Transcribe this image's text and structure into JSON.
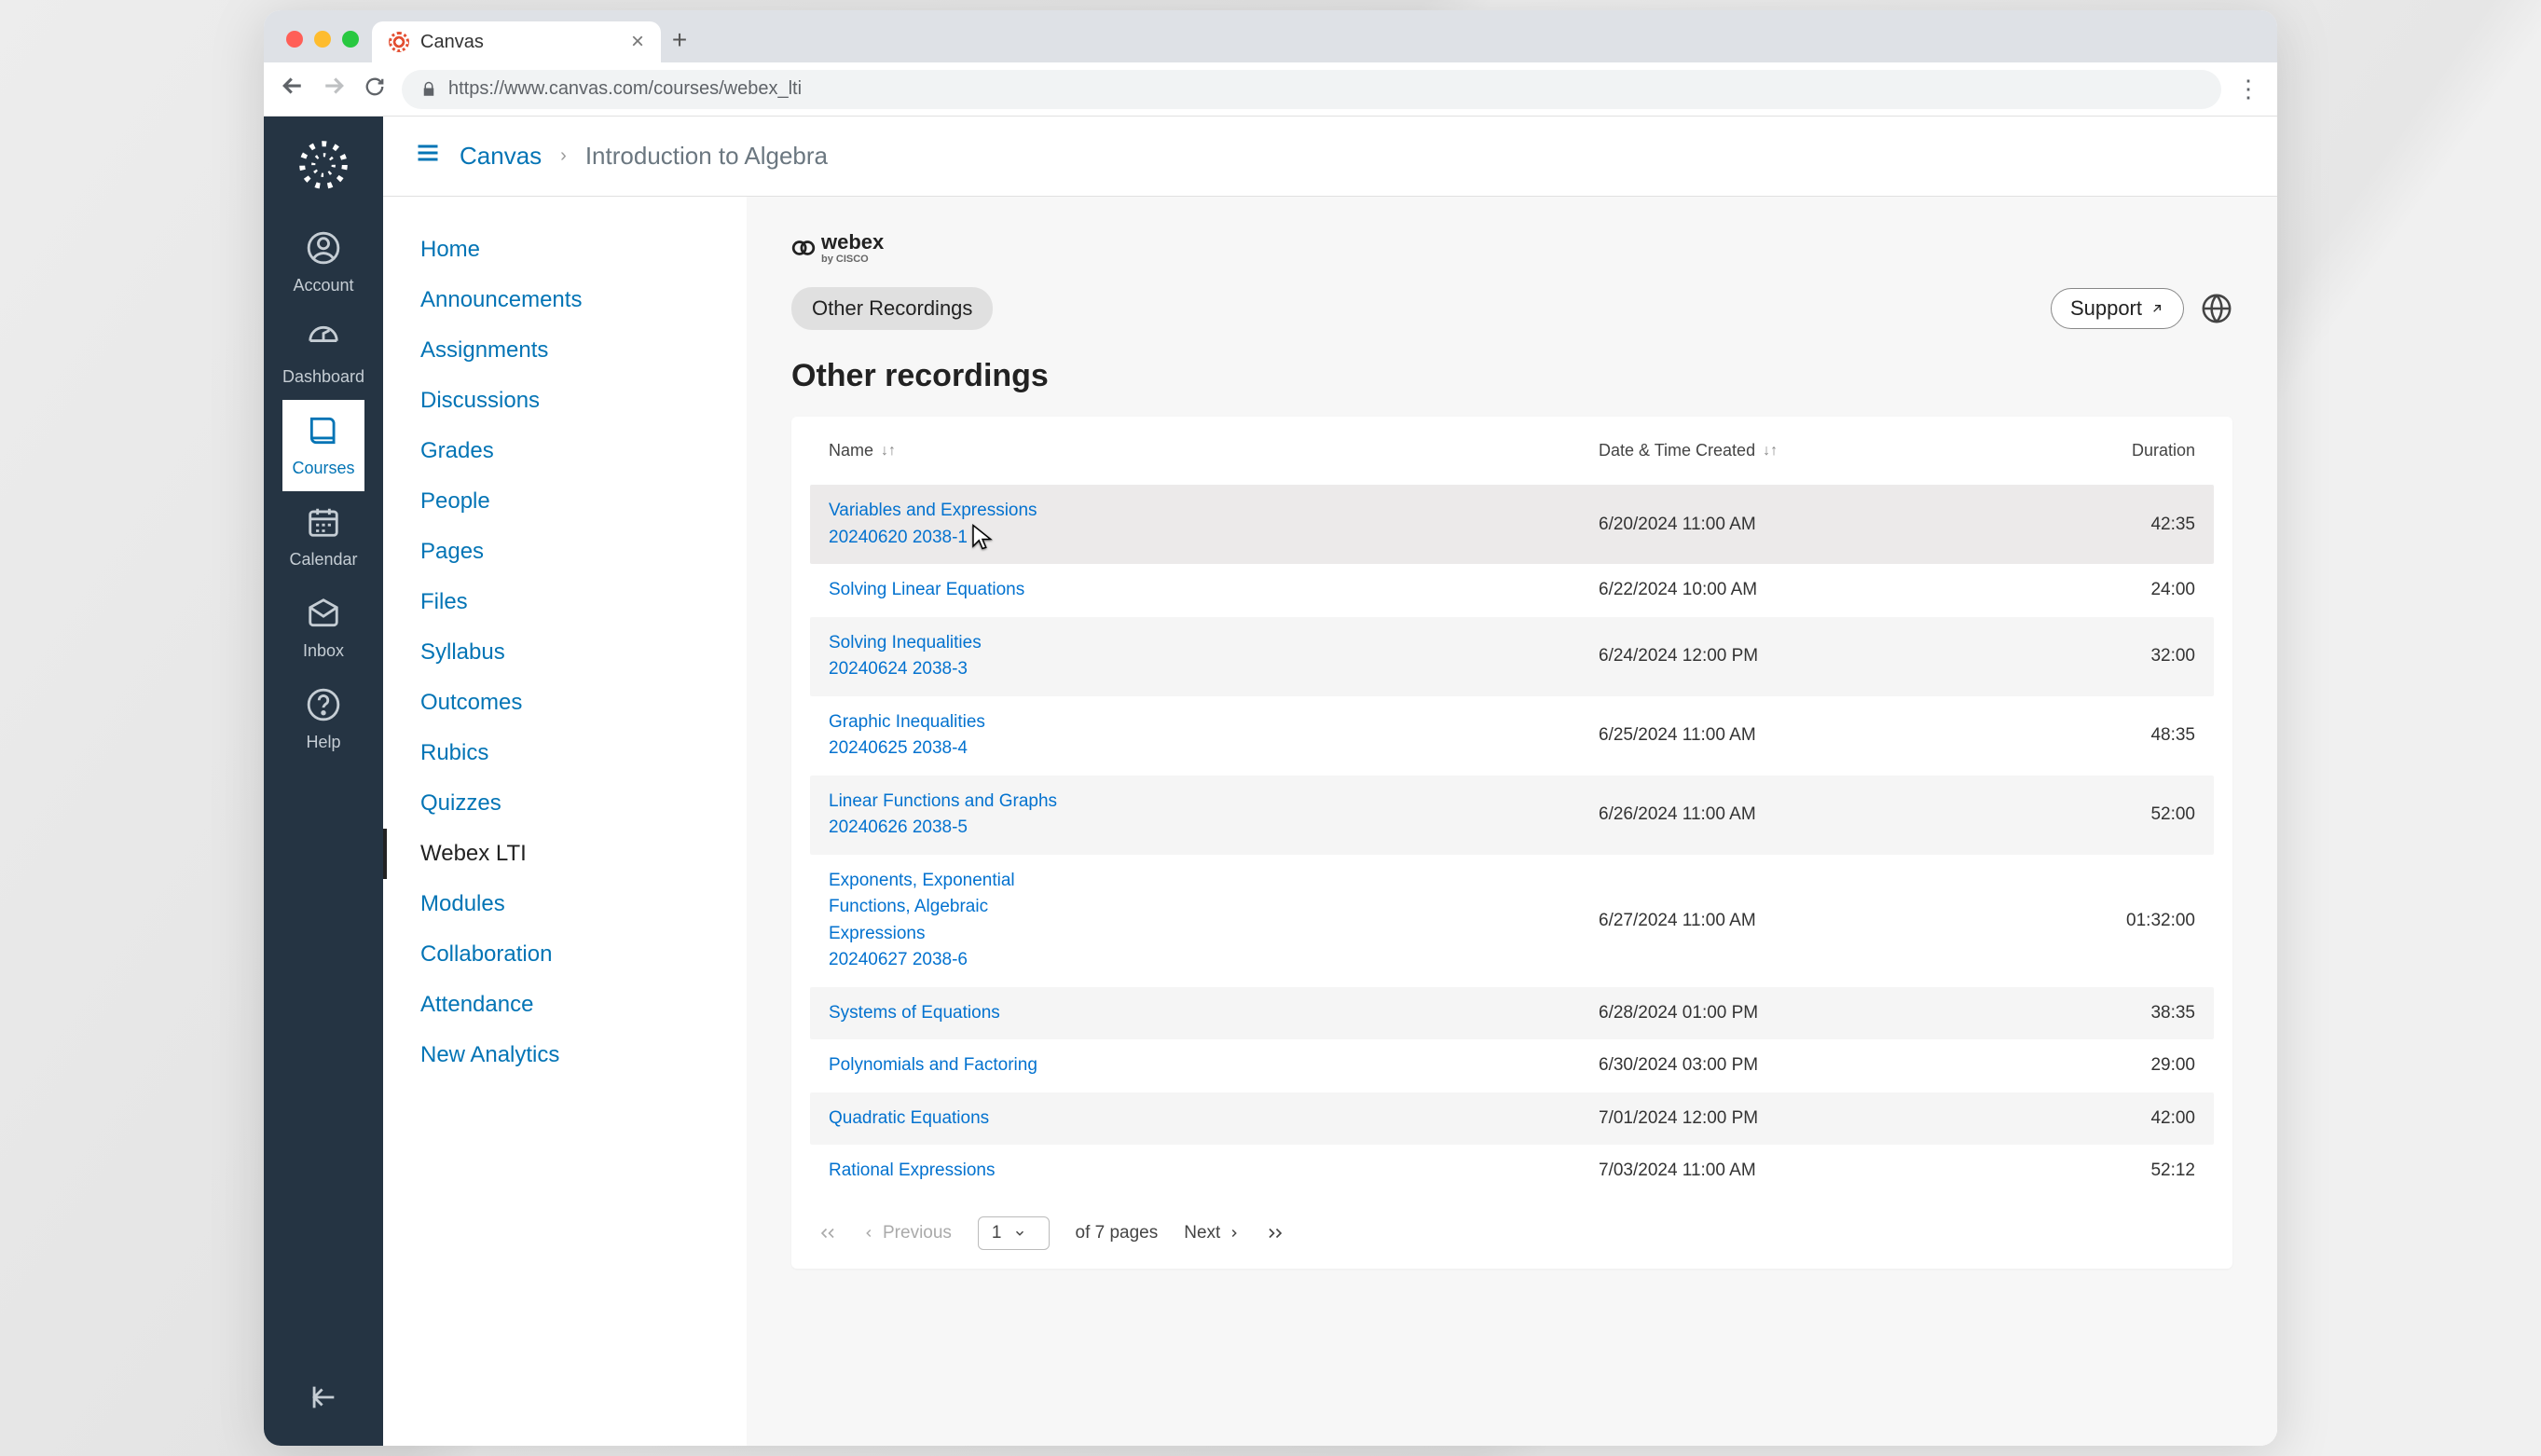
{
  "browser": {
    "tab_title": "Canvas",
    "url": "https://www.canvas.com/courses/webex_lti"
  },
  "global_nav": {
    "items": [
      {
        "label": "Account"
      },
      {
        "label": "Dashboard"
      },
      {
        "label": "Courses"
      },
      {
        "label": "Calendar"
      },
      {
        "label": "Inbox"
      },
      {
        "label": "Help"
      }
    ]
  },
  "breadcrumb": {
    "root": "Canvas",
    "current": "Introduction to Algebra"
  },
  "course_nav": {
    "items": [
      "Home",
      "Announcements",
      "Assignments",
      "Discussions",
      "Grades",
      "People",
      "Pages",
      "Files",
      "Syllabus",
      "Outcomes",
      "Rubics",
      "Quizzes",
      "Webex LTI",
      "Modules",
      "Collaboration",
      "Attendance",
      "New Analytics"
    ],
    "active": "Webex LTI"
  },
  "webex": {
    "brand": "webex",
    "pill_label": "Other Recordings",
    "support_label": "Support",
    "section_title": "Other recordings"
  },
  "table": {
    "headers": {
      "name": "Name",
      "date": "Date & Time Created",
      "duration": "Duration"
    },
    "rows": [
      {
        "name_lines": [
          "Variables and Expressions",
          "20240620 2038-1"
        ],
        "date": "6/20/2024 11:00 AM",
        "duration": "42:35"
      },
      {
        "name_lines": [
          "Solving Linear Equations"
        ],
        "date": "6/22/2024 10:00 AM",
        "duration": "24:00"
      },
      {
        "name_lines": [
          "Solving Inequalities",
          "20240624 2038-3"
        ],
        "date": "6/24/2024 12:00 PM",
        "duration": "32:00"
      },
      {
        "name_lines": [
          "Graphic Inequalities",
          "20240625 2038-4"
        ],
        "date": "6/25/2024 11:00 AM",
        "duration": "48:35"
      },
      {
        "name_lines": [
          "Linear Functions and Graphs",
          "20240626 2038-5"
        ],
        "date": "6/26/2024 11:00 AM",
        "duration": "52:00"
      },
      {
        "name_lines": [
          "Exponents, Exponential",
          "Functions, Algebraic",
          "Expressions",
          "20240627 2038-6"
        ],
        "date": "6/27/2024 11:00 AM",
        "duration": "01:32:00"
      },
      {
        "name_lines": [
          "Systems of Equations"
        ],
        "date": "6/28/2024 01:00 PM",
        "duration": "38:35"
      },
      {
        "name_lines": [
          "Polynomials and Factoring"
        ],
        "date": "6/30/2024 03:00 PM",
        "duration": "29:00"
      },
      {
        "name_lines": [
          "Quadratic Equations"
        ],
        "date": "7/01/2024 12:00 PM",
        "duration": "42:00"
      },
      {
        "name_lines": [
          "Rational Expressions"
        ],
        "date": "7/03/2024 11:00 AM",
        "duration": "52:12"
      }
    ]
  },
  "pager": {
    "prev": "Previous",
    "current_page": "1",
    "of_text": "of 7 pages",
    "next": "Next"
  }
}
